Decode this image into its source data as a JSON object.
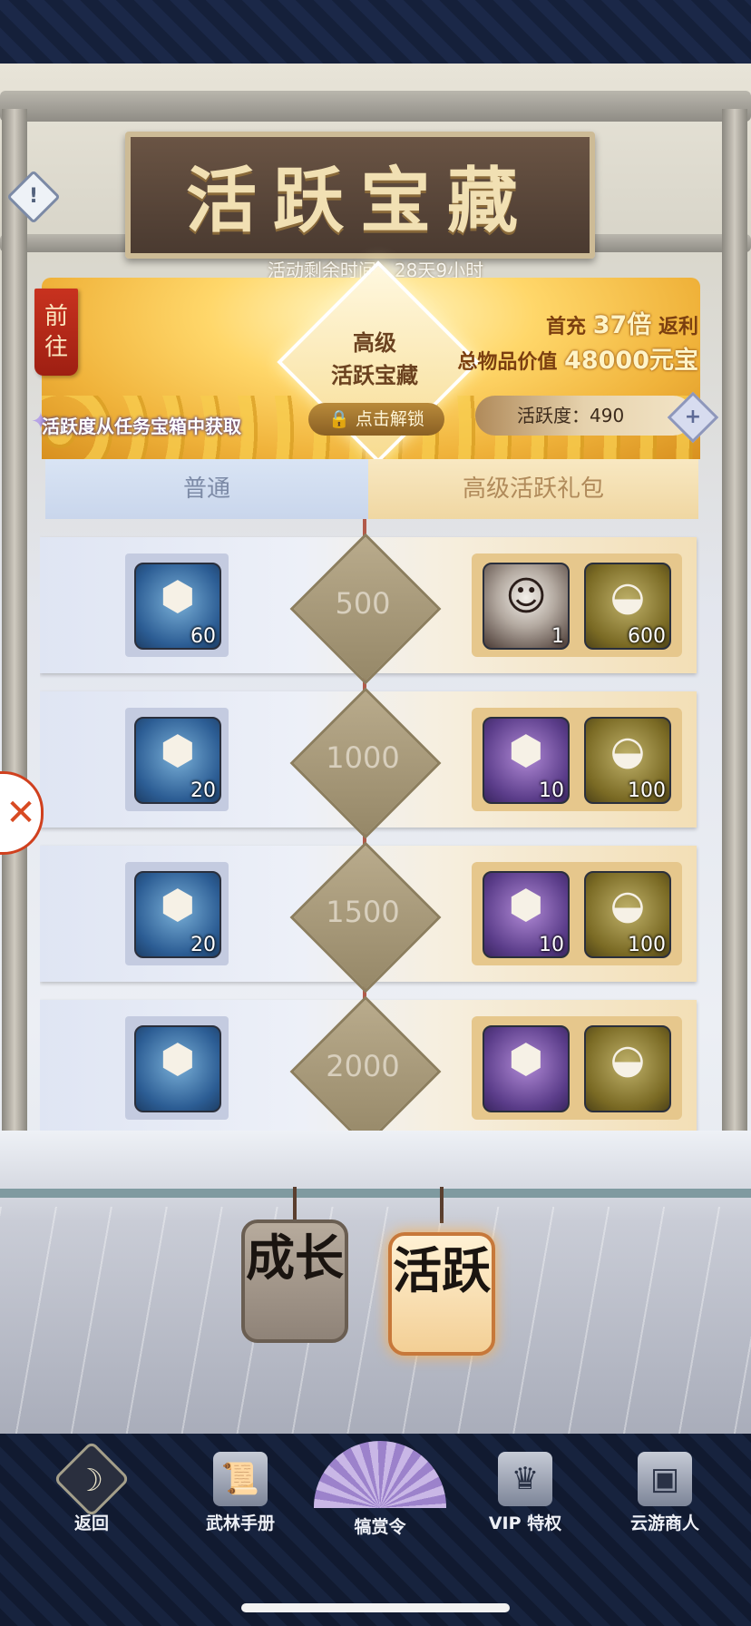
{
  "header": {
    "title": "活跃宝藏",
    "timer": "活动剩余时间：28天9小时"
  },
  "banner": {
    "goto_tag": "前往",
    "center_title_line1": "高级",
    "center_title_line2": "活跃宝藏",
    "unlock_label": "点击解锁",
    "first_charge_label": "首充",
    "first_charge_multiplier": "37倍",
    "first_charge_rebate": "返利",
    "total_value_label": "总物品价值",
    "total_value": "48000元宝",
    "hint": "活跃度从任务宝箱中获取",
    "activity_label": "活跃度：490"
  },
  "tabs": {
    "normal": "普通",
    "premium": "高级活跃礼包"
  },
  "rows": [
    {
      "milestone": "500",
      "normal_qty": "60",
      "premium": [
        {
          "icon": "portrait-icon",
          "qty": "1"
        },
        {
          "icon": "gold-ingot-icon",
          "qty": "600"
        }
      ]
    },
    {
      "milestone": "1000",
      "normal_qty": "20",
      "premium": [
        {
          "icon": "purple-token-icon",
          "qty": "10"
        },
        {
          "icon": "gold-ingot-icon",
          "qty": "100"
        }
      ]
    },
    {
      "milestone": "1500",
      "normal_qty": "20",
      "premium": [
        {
          "icon": "purple-token-icon",
          "qty": "10"
        },
        {
          "icon": "gold-ingot-icon",
          "qty": "100"
        }
      ]
    },
    {
      "milestone": "2000",
      "normal_qty": "",
      "premium": [
        {
          "icon": "purple-token-icon",
          "qty": ""
        },
        {
          "icon": "gold-ingot-icon",
          "qty": ""
        }
      ]
    }
  ],
  "lanterns": {
    "grow": "成长",
    "active": "活跃"
  },
  "nav": {
    "back": "返回",
    "manual": "武林手册",
    "bounty": "犒赏令",
    "vip": "VIP 特权",
    "merchant": "云游商人"
  },
  "colors": {
    "accent_gold": "#f0b33b",
    "tag_red": "#c8321f",
    "nav_bg": "#111a30"
  }
}
